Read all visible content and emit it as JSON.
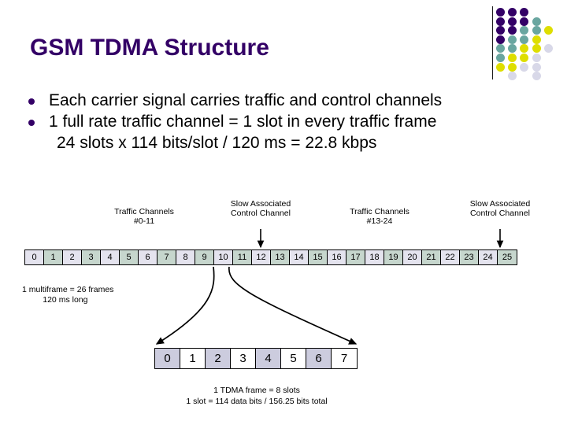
{
  "slide": {
    "title": "GSM TDMA Structure",
    "title_color": "#330066"
  },
  "decoration": {
    "name": "dot-grid",
    "colors": {
      "purple": "#330066",
      "teal": "#6aa6a0",
      "yellow": "#dede00",
      "lavender": "#d8d8e8"
    },
    "rule_color": "#1d1d1d"
  },
  "bullets": [
    {
      "text": "Each carrier signal carries traffic and control channels"
    },
    {
      "text": "1 full rate traffic channel = 1 slot in every traffic frame"
    }
  ],
  "sub_line": "24 slots x 114 bits/slot / 120 ms = 22.8 kbps",
  "diagram": {
    "labels": {
      "traffic_left_line1": "Traffic Channels",
      "traffic_left_line2": "#0-11",
      "sacch_left_line1": "Slow Associated",
      "sacch_left_line2": "Control Channel",
      "traffic_right_line1": "Traffic Channels",
      "traffic_right_line2": "#13-24",
      "sacch_right_line1": "Slow Associated",
      "sacch_right_line2": "Control Channel"
    },
    "multiframe": {
      "cells": [
        "0",
        "1",
        "2",
        "3",
        "4",
        "5",
        "6",
        "7",
        "8",
        "9",
        "10",
        "11",
        "12",
        "13",
        "14",
        "15",
        "16",
        "17",
        "18",
        "19",
        "20",
        "21",
        "22",
        "23",
        "24",
        "25"
      ],
      "fill_even": "#e4e3ee",
      "fill_odd": "#c6d6cd",
      "note_line1": "1 multiframe = 26 frames",
      "note_line2": "120 ms long"
    },
    "tdmaframe": {
      "cells": [
        "0",
        "1",
        "2",
        "3",
        "4",
        "5",
        "6",
        "7"
      ],
      "fill_even": "#ccccde",
      "fill_odd": "#ffffff",
      "note_line1": "1 TDMA frame = 8 slots",
      "note_line2": "1 slot = 114 data bits / 156.25 bits total"
    }
  }
}
